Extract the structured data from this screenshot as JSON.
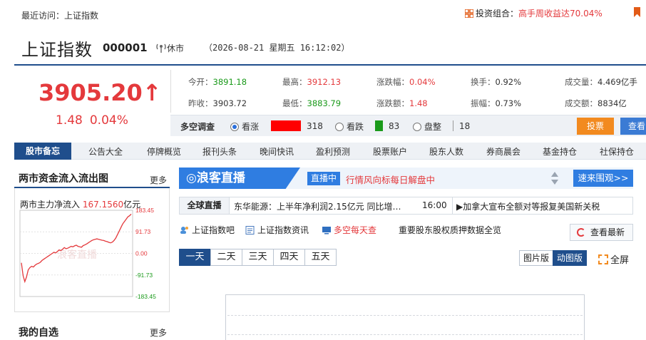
{
  "top": {
    "recent_label": "最近访问：上证指数",
    "portfolio_label": "投资组合：",
    "portfolio_text": "高手周收益达70.04%"
  },
  "header": {
    "title": "上证指数",
    "code": "000001",
    "status": "休市",
    "datetime": "（2026-08-21 星期五 16:12:02）"
  },
  "price": {
    "value": "3905.20",
    "change": "1.48",
    "change_pct": "0.04%",
    "up_color": "#e4393c"
  },
  "quote": {
    "open_label": "今开：",
    "open": "3891.18",
    "high_label": "最高：",
    "high": "3912.13",
    "pct_label": "涨跌幅：",
    "pct": "0.04%",
    "turnover_label": "换手：",
    "turnover": "0.92%",
    "volume_label": "成交量：",
    "volume": "4.469亿手",
    "prev_label": "昨收：",
    "prev": "3903.72",
    "low_label": "最低：",
    "low": "3883.79",
    "chg_label": "涨跌额：",
    "chg": "1.48",
    "amp_label": "振幅：",
    "amp": "0.73%",
    "amount_label": "成交额：",
    "amount": "8834亿"
  },
  "survey": {
    "title": "多空调查",
    "up_label": "看涨",
    "up_count": "318",
    "down_label": "看跌",
    "down_count": "83",
    "flat_label": "盘整",
    "flat_count": "18",
    "vote_button": "投票",
    "view_button": "查看"
  },
  "nav": {
    "first": "股市备忘",
    "items": [
      "公告大全",
      "停牌概览",
      "报刊头条",
      "晚间快讯",
      "盈利预测",
      "股票账户",
      "股东人数",
      "券商晨会",
      "基金持仓",
      "社保持仓"
    ]
  },
  "flow": {
    "title": "两市资金流入流出图",
    "more": "更多",
    "label": "两市主力净流入",
    "value": "167.1560",
    "unit": "亿元",
    "y_ticks": [
      "183.45",
      "91.73",
      "0.00",
      "-91.73",
      "-183.45"
    ]
  },
  "watchlist": {
    "title": "我的自选",
    "more": "更多"
  },
  "live": {
    "logo": "◎浪客直播",
    "tag": "直播中",
    "text": "行情风向标每日解盘中",
    "button": "速来围观>>"
  },
  "ticker": {
    "label": "全球直播",
    "news": "东华能源：上半年净利润2.15亿元 同比增…",
    "time": "16:00",
    "news2": "▶加拿大宣布全额对等报复美国新关税"
  },
  "links": {
    "bar": "上证指数吧",
    "info": "上证指数资讯",
    "daily": "多空每天查",
    "pledge": "重要股东股权质押数据全览",
    "refresh": "查看最新"
  },
  "periods": [
    "一天",
    "二天",
    "三天",
    "四天",
    "五天"
  ],
  "view_tabs": [
    "图片版",
    "动图版"
  ],
  "fullscreen": "全屏",
  "chart_data": {
    "type": "line",
    "title": "两市主力净流入",
    "ylim": [
      -183.45,
      183.45
    ],
    "y_ticks": [
      183.45,
      91.73,
      0.0,
      -91.73,
      -183.45
    ],
    "values": [
      -40,
      -95,
      -120,
      -100,
      -70,
      -60,
      -55,
      -58,
      -50,
      -45,
      -42,
      -38,
      -30,
      -25,
      -20,
      -15,
      -10,
      -5,
      0,
      5,
      2,
      8,
      15,
      12,
      18,
      25,
      20,
      22,
      26,
      30,
      28,
      32,
      35,
      30,
      28,
      26,
      33,
      36,
      40,
      45,
      50,
      55,
      58,
      60,
      62,
      60,
      58,
      56,
      55,
      52,
      50,
      47,
      45,
      48,
      55,
      65,
      80,
      95,
      110,
      125,
      135,
      145,
      155,
      160,
      167.156
    ]
  }
}
